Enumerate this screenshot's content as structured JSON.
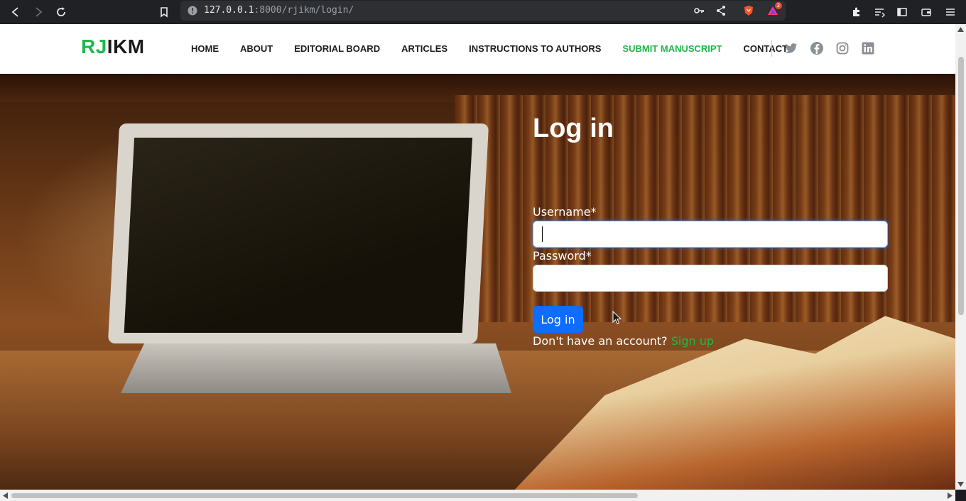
{
  "browser": {
    "url_host": "127.0.0.1",
    "url_rest": ":8000/rjikm/login/",
    "notification_count": "2"
  },
  "header": {
    "logo_accent": "RJ",
    "logo_rest": "IKM",
    "nav": [
      {
        "label": "HOME"
      },
      {
        "label": "ABOUT"
      },
      {
        "label": "EDITORIAL BOARD"
      },
      {
        "label": "ARTICLES"
      },
      {
        "label": "INSTRUCTIONS TO AUTHORS"
      },
      {
        "label": "SUBMIT MANUSCRIPT"
      },
      {
        "label": "CONTACT"
      }
    ],
    "highlight_nav": "SUBMIT MANUSCRIPT",
    "social_icons": [
      "twitter-icon",
      "facebook-icon",
      "instagram-icon",
      "linkedin-icon"
    ]
  },
  "login": {
    "title": "Log in",
    "username_label": "Username*",
    "username_value": "",
    "password_label": "Password*",
    "password_value": "",
    "submit_label": "Log in",
    "signup_prompt": "Don't have an account?",
    "signup_link": "Sign up"
  },
  "colors": {
    "accent_green": "#1fb84a",
    "primary_blue": "#0d6efd"
  }
}
